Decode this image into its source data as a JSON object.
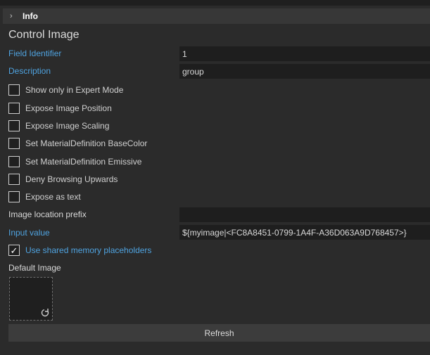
{
  "header": {
    "title": "Info",
    "collapsed": true
  },
  "panel": {
    "title": "Control Image"
  },
  "fields": {
    "field_identifier": {
      "label": "Field Identifier",
      "value": "1"
    },
    "description": {
      "label": "Description",
      "value": "group"
    },
    "image_location_prefix": {
      "label": "Image location prefix",
      "value": ""
    },
    "input_value": {
      "label": "Input value",
      "value": "${myimage|<FC8A8451-0799-1A4F-A36D063A9D768457>}"
    }
  },
  "checkboxes": [
    {
      "label": "Show only in Expert Mode",
      "checked": false
    },
    {
      "label": "Expose Image Position",
      "checked": false
    },
    {
      "label": "Expose Image Scaling",
      "checked": false
    },
    {
      "label": "Set MaterialDefinition BaseColor",
      "checked": false
    },
    {
      "label": "Set MaterialDefinition Emissive",
      "checked": false
    },
    {
      "label": "Deny Browsing Upwards",
      "checked": false
    },
    {
      "label": "Expose as text",
      "checked": false
    }
  ],
  "shared_memory": {
    "label": "Use shared memory placeholders",
    "checked": true,
    "check_glyph": "✓"
  },
  "default_image": {
    "label": "Default Image",
    "icon": "reload-icon"
  },
  "refresh_button": {
    "label": "Refresh"
  },
  "colors": {
    "accent_label": "#4fa3e0",
    "background": "#2b2b2b",
    "field_bg": "#1e1e1e"
  }
}
